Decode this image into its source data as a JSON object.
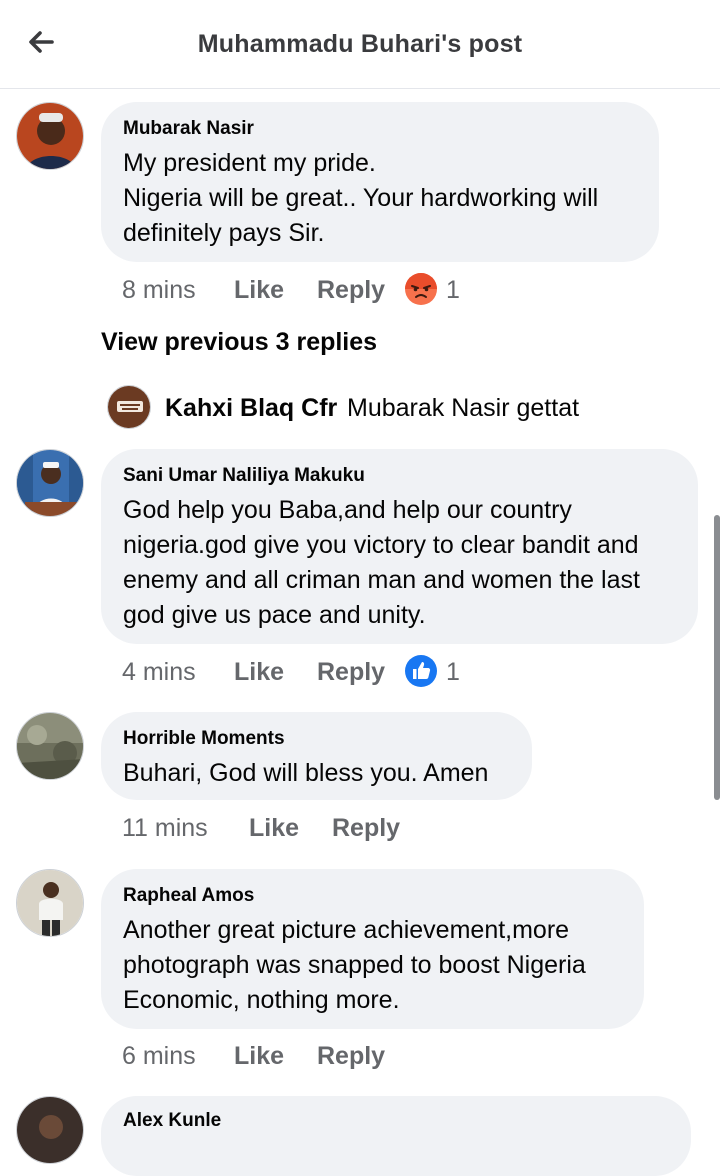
{
  "header": {
    "title": "Muhammadu Buhari's post"
  },
  "comments": [
    {
      "author": "Mubarak Nasir",
      "lines": [
        "My president my pride.",
        "Nigeria will be great.. Your hardworking will",
        "definitely pays Sir."
      ],
      "time": "8 mins",
      "like": "Like",
      "reply": "Reply",
      "reaction": "angry",
      "reaction_count": "1"
    },
    {
      "author": "Sani Umar Naliliya Makuku",
      "lines": [
        "God help you Baba,and help our country",
        "nigeria.god give you victory to clear bandit and",
        "enemy and all criman man and women the last",
        "god give us pace and unity."
      ],
      "time": "4 mins",
      "like": "Like",
      "reply": "Reply",
      "reaction": "like",
      "reaction_count": "1"
    },
    {
      "author": "Horrible Moments",
      "lines": [
        "Buhari, God will bless you. Amen"
      ],
      "time": "11 mins",
      "like": "Like",
      "reply": "Reply"
    },
    {
      "author": "Rapheal Amos",
      "lines": [
        "Another great picture achievement,more",
        "photograph was snapped to boost Nigeria",
        "Economic, nothing more."
      ],
      "time": "6 mins",
      "like": "Like",
      "reply": "Reply"
    },
    {
      "author": "Alex Kunle",
      "lines": []
    }
  ],
  "view_previous": "View previous 3 replies",
  "reply_preview": {
    "author": "Kahxi Blaq Cfr",
    "text": "Mubarak Nasir gettat"
  },
  "colors": {
    "like_blue": "#1877f2",
    "angry_orange": "#f7714c",
    "meta_gray": "#65676b",
    "bubble_bg": "#f0f2f5"
  }
}
